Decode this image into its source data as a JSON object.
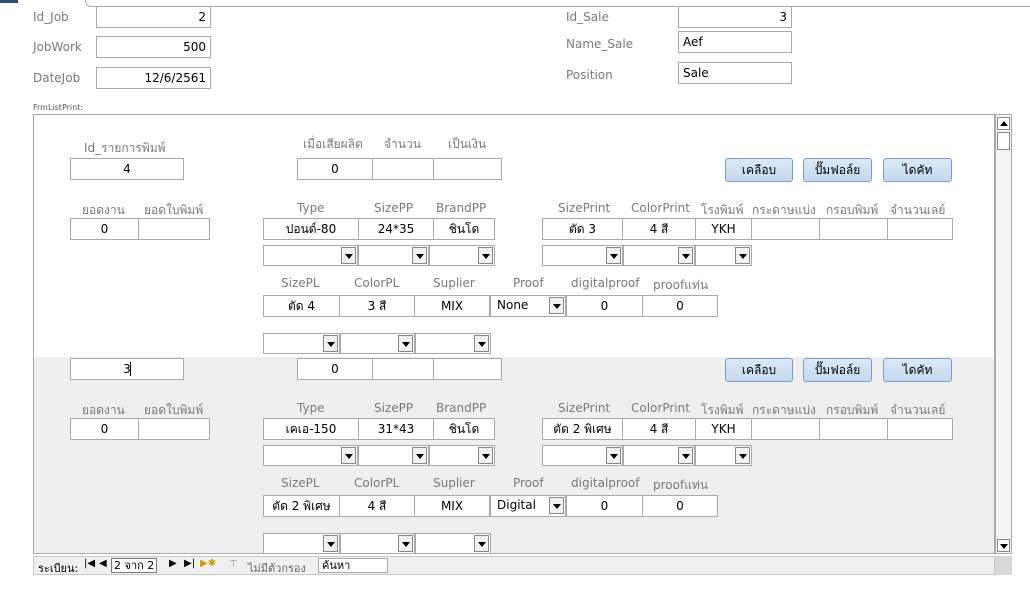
{
  "form": {
    "id_job_label": "Id_Job",
    "id_job_value": "2",
    "jobwork_label": "JobWork",
    "jobwork_value": "500",
    "datejob_label": "DateJob",
    "datejob_value": "12/6/2561",
    "id_sale_label": "Id_Sale",
    "id_sale_value": "3",
    "name_sale_label": "Name_Sale",
    "name_sale_value": "Aef",
    "position_label": "Position",
    "position_value": "Sale",
    "subform_label": "FrmListPrint:"
  },
  "headers": {
    "id_print": "Id_รายการพิมพ์",
    "damage": "เมื่อเสียผลิต",
    "qty": "จำนวน",
    "money": "เป็นเงิน",
    "yodngan": "ยอดงาน",
    "yodbaiprint": "ยอดใบพิมพ์",
    "type": "Type",
    "sizepp": "SizePP",
    "brandpp": "BrandPP",
    "sizeprint": "SizePrint",
    "colorprint": "ColorPrint",
    "printhouse": "โรงพิมพ์",
    "paperdiv": "กระดาษแบ่ง",
    "frame": "กรอบพิมพ์",
    "number": "จำนวนเลย์",
    "sizepl": "SizePL",
    "colorpl": "ColorPL",
    "supplier": "Suplier",
    "proof": "Proof",
    "digitalproof": "digitalproof",
    "proofnan": "proofแท่น"
  },
  "buttons": {
    "laminate": "เคลือบ",
    "foil": "ปั๊มฟอล์ย",
    "diecut": "ไดคัท"
  },
  "records": [
    {
      "id_print": "4",
      "damage": "0",
      "qty": "",
      "money": "",
      "yodngan": "0",
      "yodbaiprint": "",
      "type": "ปอนด์-80",
      "sizepp": "24*35",
      "brandpp": "ชินโด",
      "sizeprint": "ตัด 3",
      "colorprint": "4 สี",
      "printhouse": "YKH",
      "paperdiv": "",
      "frame": "",
      "number": "",
      "sizepl": "ตัด 4",
      "colorpl": "3 สี",
      "supplier": "MIX",
      "proof": "None",
      "digitalproof": "0",
      "proofnan": "0"
    },
    {
      "id_print": "3",
      "damage": "0",
      "qty": "",
      "money": "",
      "yodngan": "0",
      "yodbaiprint": "",
      "type": "เคเอ-150",
      "sizepp": "31*43",
      "brandpp": "ชินโด",
      "sizeprint": "ตัด 2 พิเศษ",
      "colorprint": "4 สี",
      "printhouse": "YKH",
      "paperdiv": "",
      "frame": "",
      "number": "",
      "sizepl": "ตัด 2 พิเศษ",
      "colorpl": "4 สี",
      "supplier": "MIX",
      "proof": "Digital",
      "digitalproof": "0",
      "proofnan": "0"
    }
  ],
  "navigation": {
    "record_label": "ระเบียน:",
    "record_position": "2 จาก 2",
    "filter_label": "ไม่มีตัวกรอง",
    "search_label": "ค้นหา"
  },
  "icons": {
    "first": "first-record-icon",
    "prev": "prev-record-icon",
    "next": "next-record-icon",
    "last": "last-record-icon",
    "new": "new-record-icon",
    "filter": "filter-icon"
  }
}
